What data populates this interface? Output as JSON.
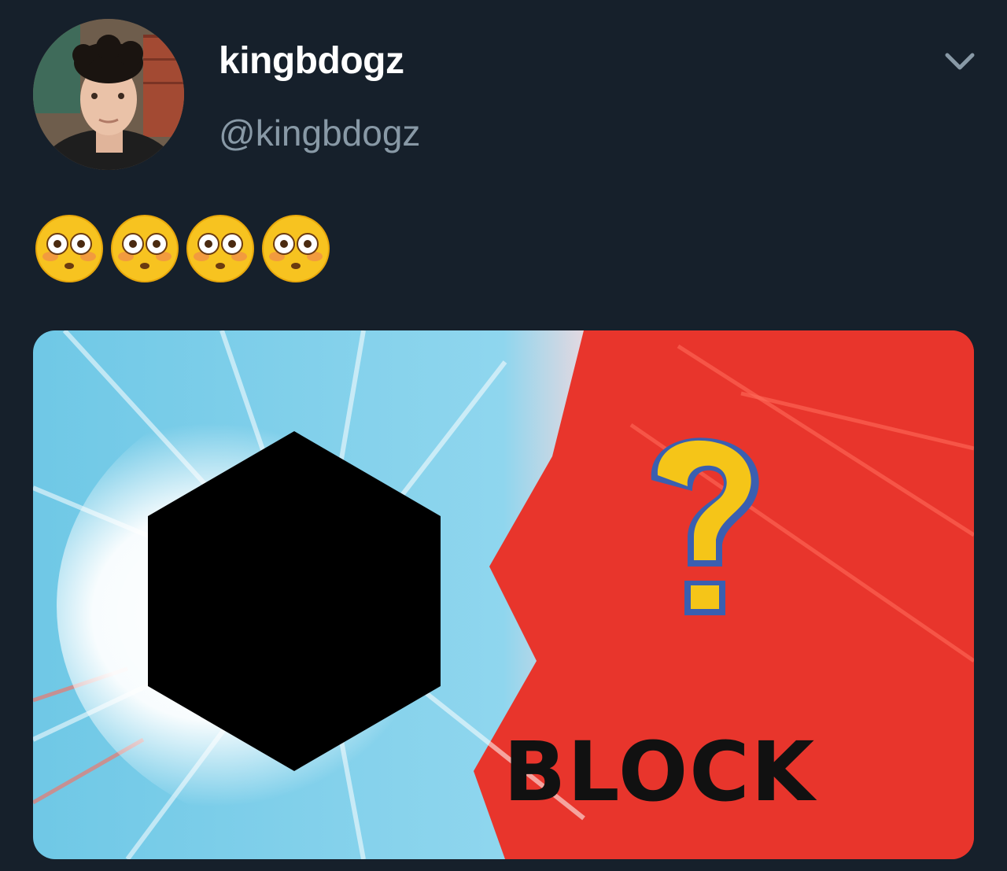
{
  "tweet": {
    "display_name": "kingbdogz",
    "handle": "@kingbdogz",
    "text": "😳😳😳😳",
    "emoji_icons": [
      "flushed-face-icon",
      "flushed-face-icon",
      "flushed-face-icon",
      "flushed-face-icon"
    ],
    "media": {
      "caption": "BLOCK",
      "icons": [
        "hexagon-silhouette",
        "question-mark-icon"
      ],
      "colors": {
        "left_burst": "#6fc8e6",
        "right_burst": "#e8352c",
        "question_fill": "#f5c518",
        "question_outline": "#3a5fb0"
      }
    }
  },
  "colors": {
    "background": "#16202b",
    "name": "#ffffff",
    "handle": "#8899a6"
  },
  "icons": {
    "menu": "chevron-down-icon"
  }
}
